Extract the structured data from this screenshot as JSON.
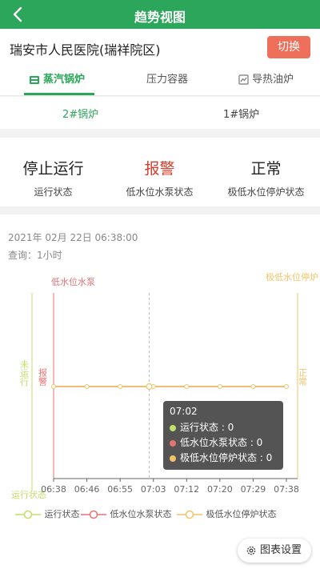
{
  "header": {
    "title": "趋势视图",
    "back_icon": "chevron-left-icon"
  },
  "hospital": {
    "name": "瑞安市人民医院(瑞祥院区)",
    "switch_label": "切换"
  },
  "tabs": [
    {
      "label": "蒸汽锅炉",
      "icon": "boiler-icon",
      "active": true
    },
    {
      "label": "压力容器",
      "icon": "",
      "active": false
    },
    {
      "label": "导热油炉",
      "icon": "oil-furnace-icon",
      "active": false
    }
  ],
  "subtabs": [
    {
      "label": "2#锅炉",
      "active": true
    },
    {
      "label": "1#锅炉",
      "active": false
    }
  ],
  "status": [
    {
      "value": "停止运行",
      "label": "运行状态"
    },
    {
      "value": "报警",
      "label": "低水位水泵状态"
    },
    {
      "value": "正常",
      "label": "极低水位停炉状态"
    }
  ],
  "chart_info": {
    "timestamp": "2021年 02月 22日 06:38:00",
    "query": "查询：1小时"
  },
  "chart_data": {
    "type": "line",
    "x": [
      "06:38",
      "06:46",
      "06:55",
      "07:03",
      "07:12",
      "07:20",
      "07:29",
      "07:38"
    ],
    "series": [
      {
        "name": "运行状态",
        "color": "#c4de6b",
        "value_label": "未运行",
        "axis_title": "运行状态",
        "values": [
          0,
          0,
          0,
          0,
          0,
          0,
          0,
          0
        ]
      },
      {
        "name": "低水位水泵状态",
        "color": "#e57373",
        "value_label": "报警",
        "axis_title": "低水位水泵",
        "values": [
          0,
          0,
          0,
          0,
          0,
          0,
          0,
          0
        ]
      },
      {
        "name": "极低水位停炉状态",
        "color": "#f2c46a",
        "value_label": "正常",
        "axis_title": "极低水位停炉",
        "values": [
          0,
          0,
          0,
          0,
          0,
          0,
          0,
          0
        ]
      }
    ],
    "highlight_x": "07:02"
  },
  "tooltip": {
    "time": "07:02",
    "rows": [
      {
        "text": "运行状态 : 0",
        "color": "#c4de6b"
      },
      {
        "text": "低水位水泵状态 : 0",
        "color": "#e57373"
      },
      {
        "text": "极低水位停炉状态 : 0",
        "color": "#f2c46a"
      }
    ]
  },
  "settings_button": {
    "label": "图表设置",
    "icon": "gear-icon"
  },
  "colors": {
    "brand": "#2ca65a",
    "alarm": "#d53b2a",
    "switch": "#ef6f5b"
  }
}
